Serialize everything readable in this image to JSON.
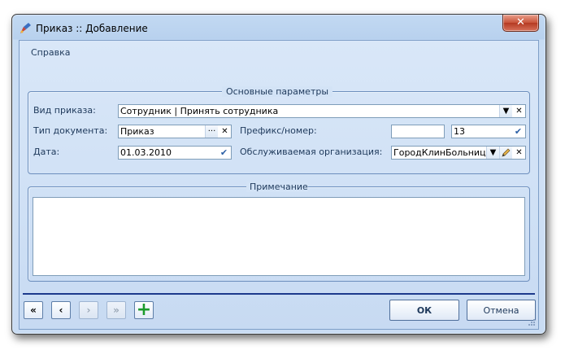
{
  "window": {
    "title": "Приказ :: Добавление",
    "close_glyph": "✕"
  },
  "menu": {
    "help": "Справка"
  },
  "main_params": {
    "legend": "Основные параметры",
    "order_type_label": "Вид приказа:",
    "order_type_value": "Сотрудник | Принять сотрудника",
    "doc_type_label": "Тип документа:",
    "doc_type_value": "Приказ",
    "date_label": "Дата:",
    "date_value": "01.03.2010",
    "prefix_label": "Префикс/номер:",
    "prefix_value": "",
    "number_value": "13",
    "org_label": "Обслуживаемая организация:",
    "org_value": "ГородКлинБольница..."
  },
  "note": {
    "legend": "Примечание",
    "text": ""
  },
  "navigation": {
    "first": "«",
    "prev": "‹",
    "next": "›",
    "last": "»",
    "add": "+"
  },
  "buttons": {
    "ok": "ОК",
    "cancel": "Отмена"
  },
  "glyphs": {
    "dropdown": "▼",
    "clear": "✕",
    "ellipsis": "···",
    "check": "✔"
  }
}
